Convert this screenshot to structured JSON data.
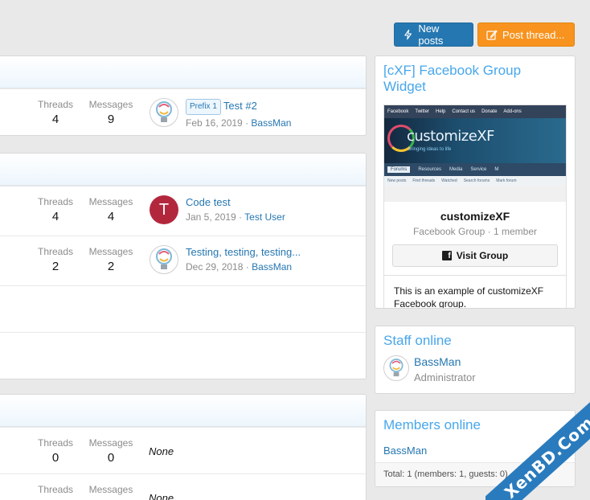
{
  "actions": {
    "new_posts": "New posts",
    "post_thread": "Post thread..."
  },
  "labels": {
    "threads": "Threads",
    "messages": "Messages",
    "none": "None"
  },
  "groups": [
    {
      "nodes": [
        {
          "threads": "4",
          "messages": "9",
          "prefix": "Prefix 1",
          "title": "Test #2",
          "date": "Feb 16, 2019",
          "user": "BassMan",
          "avatar": "bulb"
        }
      ]
    },
    {
      "nodes": [
        {
          "threads": "4",
          "messages": "4",
          "title": "Code test",
          "date": "Jan 5, 2019",
          "user": "Test User",
          "avatar": "T"
        },
        {
          "threads": "2",
          "messages": "2",
          "title": "Testing, testing, testing...",
          "date": "Dec 29, 2018",
          "user": "BassMan",
          "avatar": "bulb"
        }
      ]
    },
    {
      "nodes": [
        {
          "threads": "0",
          "messages": "0",
          "latest": "None"
        },
        {
          "threads": "0",
          "messages": "0",
          "latest": "None"
        }
      ]
    }
  ],
  "sep": " · ",
  "fb_widget": {
    "title": "[cXF] Facebook Group Widget",
    "cover": {
      "top_links": [
        "Facebook",
        "Twitter",
        "Help",
        "Contact us",
        "Donate",
        "Add-ons"
      ],
      "logo_text": "customizeXF",
      "tagline": "bringing ideas to life",
      "nav": [
        "Forums",
        "Resources",
        "Media",
        "Service",
        "M"
      ],
      "sub": [
        "New posts",
        "Find threads",
        "Watched",
        "Search forums",
        "Mark forum"
      ]
    },
    "name": "customizeXF",
    "info": "Facebook Group · 1 member",
    "button": "Visit Group",
    "description": "This is an example of customizeXF Facebook group."
  },
  "staff_online": {
    "title": "Staff online",
    "name": "BassMan",
    "role": "Administrator"
  },
  "members_online": {
    "title": "Members online",
    "member": "BassMan",
    "total": "Total: 1 (members: 1, guests: 0)"
  },
  "watermark": "XenBD.Com",
  "colors": {
    "accent": "#2577b1",
    "post_button": "#f7931e",
    "sidebar_title": "#47a7eb",
    "avatar_t": "#b3273d"
  }
}
